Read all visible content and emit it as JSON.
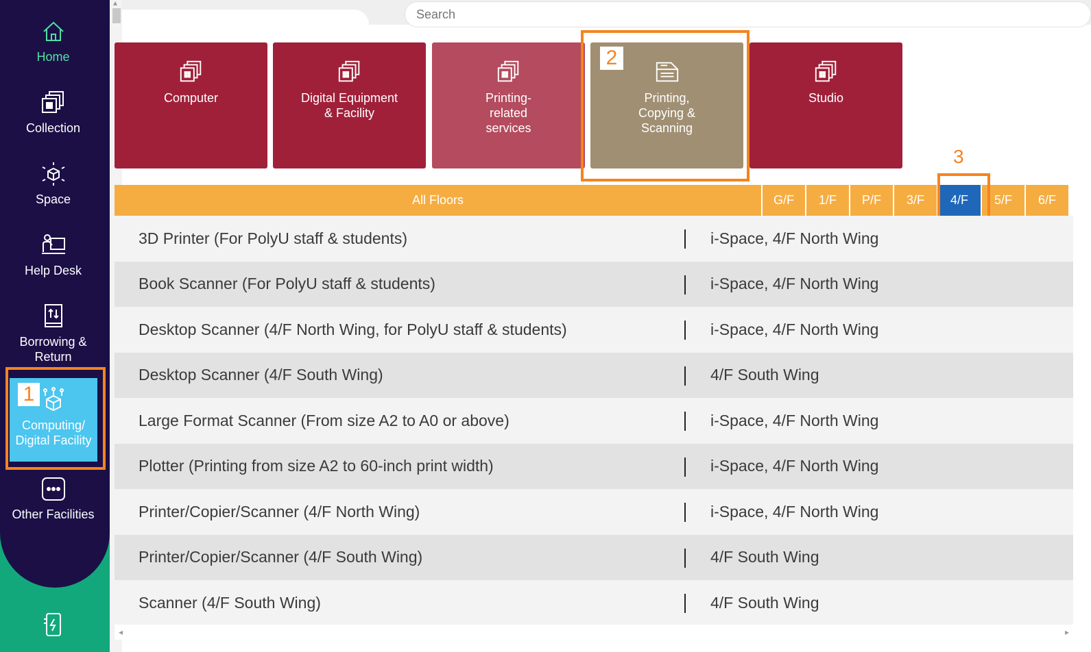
{
  "sidebar": {
    "items": [
      {
        "label": "Home",
        "icon": "home-icon"
      },
      {
        "label": "Collection",
        "icon": "collection-icon"
      },
      {
        "label": "Space",
        "icon": "space-icon"
      },
      {
        "label": "Help Desk",
        "icon": "help-desk-icon"
      },
      {
        "label": "Borrowing & Return",
        "icon": "borrowing-return-icon"
      },
      {
        "label": "Computing/ Digital Facility",
        "icon": "computing-facility-icon"
      },
      {
        "label": "Other Facilities",
        "icon": "other-facilities-icon"
      }
    ],
    "bottom_icon": "phone-charging-icon",
    "colors": {
      "dark": "#1b0f46",
      "green": "#13a87c",
      "active": "#4cc5ef"
    }
  },
  "search": {
    "placeholder": "Search"
  },
  "categories": [
    {
      "label": "Computer",
      "color": "#a0203a"
    },
    {
      "label": "Digital Equipment & Facility",
      "color": "#a0203a"
    },
    {
      "label": "Printing-related services",
      "color": "#b44b5e"
    },
    {
      "label": "Printing, Copying & Scanning",
      "color": "#a08f72"
    },
    {
      "label": "Studio",
      "color": "#a0203a"
    }
  ],
  "floors": {
    "all_label": "All Floors",
    "buttons": [
      "G/F",
      "1/F",
      "P/F",
      "3/F",
      "4/F",
      "5/F",
      "6/F"
    ],
    "selected": "4/F"
  },
  "markers": [
    "1",
    "2",
    "3"
  ],
  "facilities": [
    {
      "name": "3D Printer (For PolyU staff & students)",
      "location": "i-Space, 4/F North Wing"
    },
    {
      "name": "Book Scanner (For PolyU staff & students)",
      "location": "i-Space, 4/F North Wing"
    },
    {
      "name": "Desktop Scanner (4/F North Wing, for PolyU staff & students)",
      "location": "i-Space, 4/F North Wing"
    },
    {
      "name": "Desktop Scanner (4/F South Wing)",
      "location": "4/F South Wing"
    },
    {
      "name": "Large Format Scanner (From size A2 to A0 or above)",
      "location": "i-Space, 4/F North Wing"
    },
    {
      "name": "Plotter (Printing from size A2 to 60-inch print width)",
      "location": "i-Space, 4/F North Wing"
    },
    {
      "name": "Printer/Copier/Scanner (4/F North Wing)",
      "location": "i-Space, 4/F North Wing"
    },
    {
      "name": "Printer/Copier/Scanner (4/F South Wing)",
      "location": "4/F South Wing"
    },
    {
      "name": "Scanner (4/F South Wing)",
      "location": "4/F South Wing"
    }
  ]
}
